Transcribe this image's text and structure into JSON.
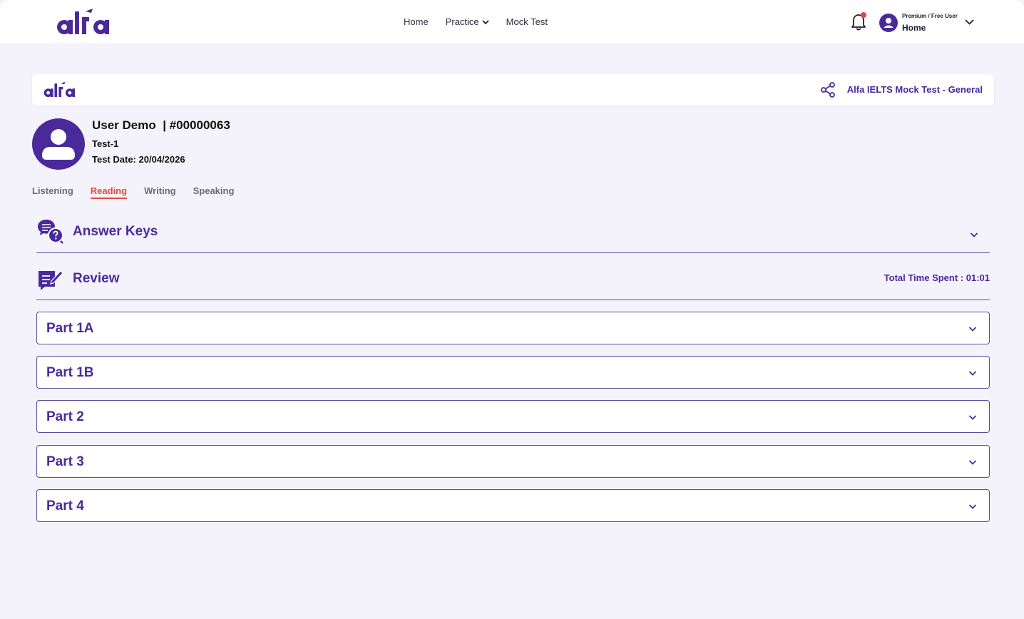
{
  "nav": {
    "links": [
      "Home",
      "Practice",
      "Mock Test"
    ],
    "user": {
      "plan": "Premium / Free User",
      "name": "Home"
    }
  },
  "header": {
    "test_title": "Alfa IELTS Mock Test - General"
  },
  "profile": {
    "name": "User Demo  | #00000063",
    "test": "Test-1",
    "date": "Test Date: 20/04/2026"
  },
  "tabs": [
    "Listening",
    "Reading",
    "Writing",
    "Speaking"
  ],
  "active_tab": "Reading",
  "answer_keys": {
    "title": "Answer Keys"
  },
  "review": {
    "title": "Review",
    "time_spent": "Total Time Spent : 01:01"
  },
  "parts": [
    "Part 1A",
    "Part 1B",
    "Part 2",
    "Part 3",
    "Part 4"
  ],
  "colors": {
    "brand": "#4a2a9a",
    "accent": "#e64a3c",
    "background": "#f4f3fb"
  }
}
